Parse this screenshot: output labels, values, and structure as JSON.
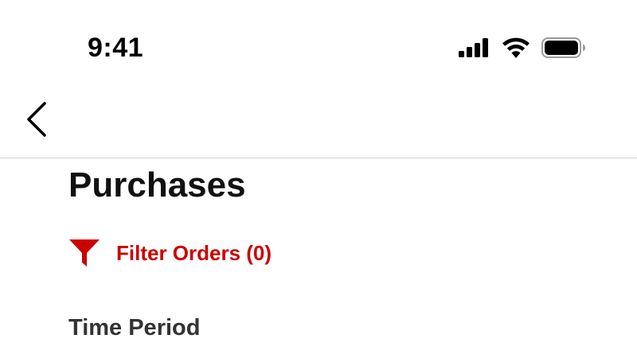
{
  "status_bar": {
    "time": "9:41",
    "icons": [
      "cellular-signal-icon",
      "wifi-icon",
      "battery-icon"
    ]
  },
  "nav": {
    "back_icon": "chevron-left-icon"
  },
  "page": {
    "title": "Purchases"
  },
  "filter": {
    "icon": "filter-funnel-icon",
    "label": "Filter Orders (0)"
  },
  "sections": {
    "time_period": {
      "heading": "Time Period"
    }
  },
  "colors": {
    "accent": "#cc0000",
    "text": "#111111",
    "section_text": "#333333",
    "divider": "#cfcfcf"
  }
}
